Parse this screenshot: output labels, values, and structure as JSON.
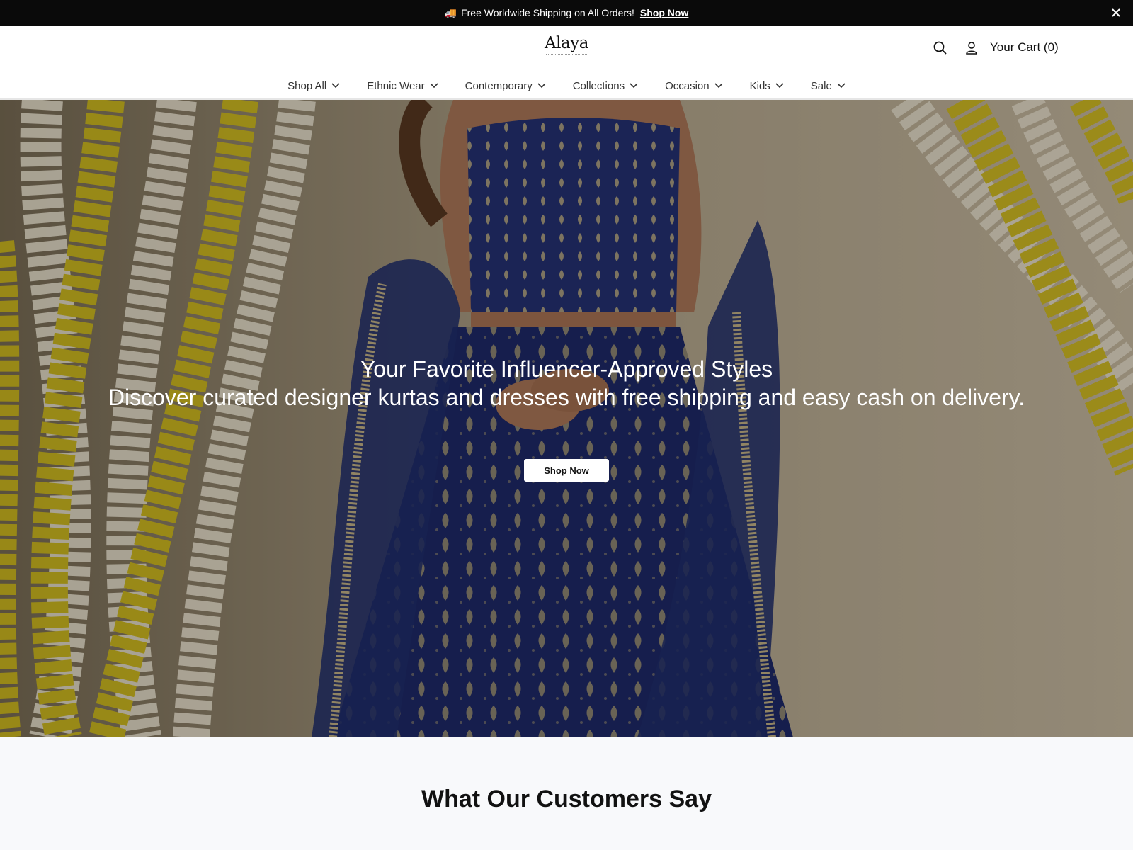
{
  "announcement": {
    "text": "Free Worldwide Shipping on All Orders!",
    "link_label": "Shop Now"
  },
  "header": {
    "logo_text": "Alaya",
    "cart_label": "Your Cart (0)"
  },
  "nav": {
    "items": [
      {
        "label": "Shop All"
      },
      {
        "label": "Ethnic Wear"
      },
      {
        "label": "Contemporary"
      },
      {
        "label": "Collections"
      },
      {
        "label": "Occasion"
      },
      {
        "label": "Kids"
      },
      {
        "label": "Sale"
      }
    ]
  },
  "hero": {
    "title": "Your Favorite Influencer-Approved Styles",
    "subtitle": "Discover curated designer kurtas and dresses with free shipping and easy cash on delivery.",
    "button_label": "Shop Now"
  },
  "testimonials": {
    "heading": "What Our Customers Say"
  }
}
